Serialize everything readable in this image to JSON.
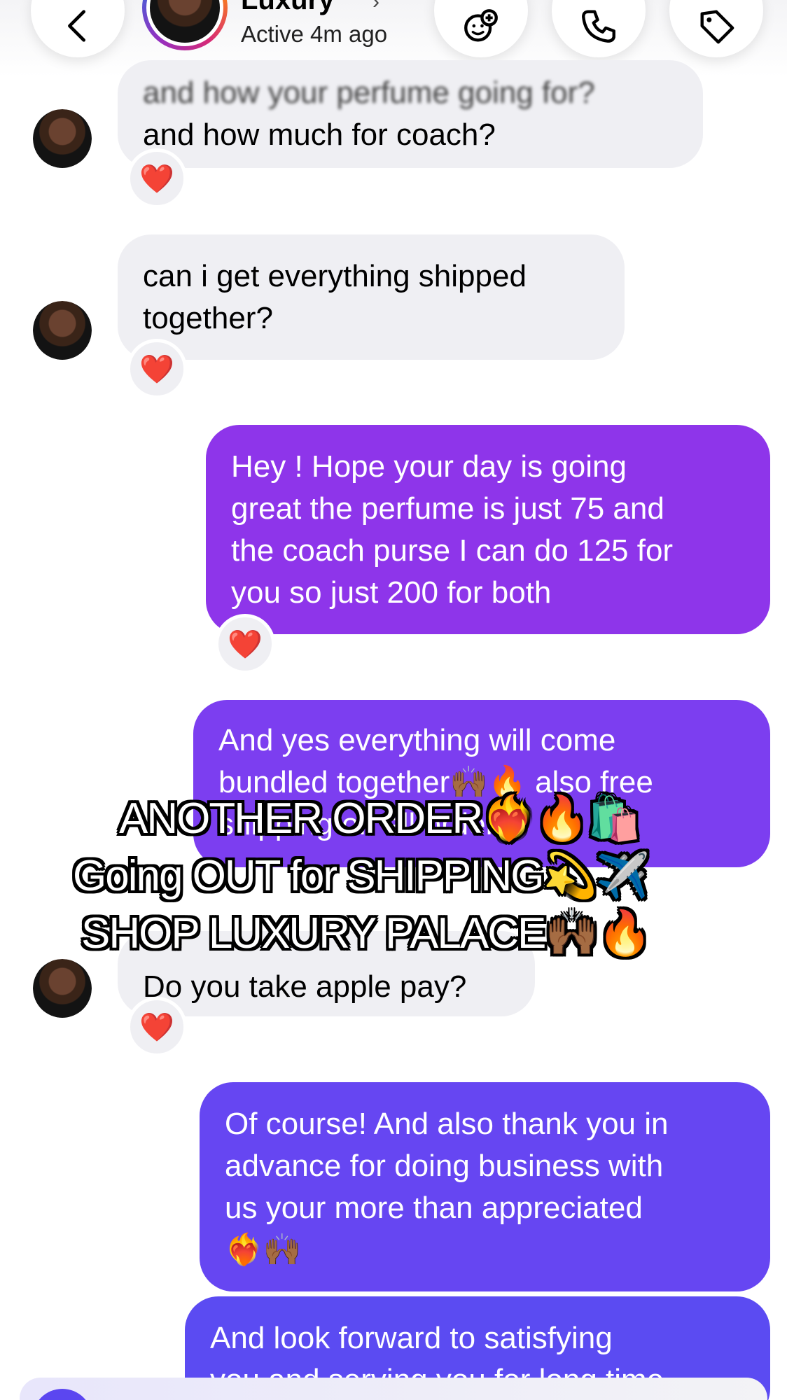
{
  "header": {
    "name": "Luxury",
    "status": "Active 4m ago"
  },
  "icons": {
    "back": "chevron-left-icon",
    "sticker": "sticker-plus-icon",
    "call": "phone-icon",
    "tag": "tag-icon",
    "reaction": "red-heart-icon"
  },
  "messages": [
    {
      "from": "them",
      "blurred_line": "and how your perfume going for?",
      "text": "and how much for coach?",
      "reaction": "❤️"
    },
    {
      "from": "them",
      "lines": [
        "can i get everything shipped",
        "together?"
      ],
      "reaction": "❤️"
    },
    {
      "from": "me",
      "lines": [
        "Hey ! Hope your day is going",
        "great the perfume is just 75 and",
        "the coach purse I can do 125 for",
        "you so just 200 for both"
      ],
      "reaction": "❤️"
    },
    {
      "from": "me",
      "lines": [
        "And yes everything will come",
        "bundled together🙌🏾🔥 also free",
        "shipping on all orders"
      ]
    },
    {
      "from": "them",
      "text": "Do you take apple pay?",
      "reaction": "❤️"
    },
    {
      "from": "me",
      "lines": [
        "Of course! And also thank you in",
        "advance for doing business with",
        "us your more than appreciated",
        "❤️‍🔥🙌🏾"
      ]
    },
    {
      "from": "me",
      "lines": [
        "And look forward to satisfying",
        "you and serving you for long time"
      ]
    }
  ],
  "overlay": {
    "lines": [
      "ANOTHER ORDER❤️‍🔥🔥🛍️",
      "Going OUT for SHIPPING💫✈️",
      "SHOP LUXURY PALACE🙌🏾🔥"
    ]
  },
  "colors": {
    "incoming_bubble": "#efeff3",
    "outgoing_top": "#8e35ea",
    "outgoing_bottom": "#5b4bf2",
    "text_on_outgoing": "#ffffff"
  }
}
